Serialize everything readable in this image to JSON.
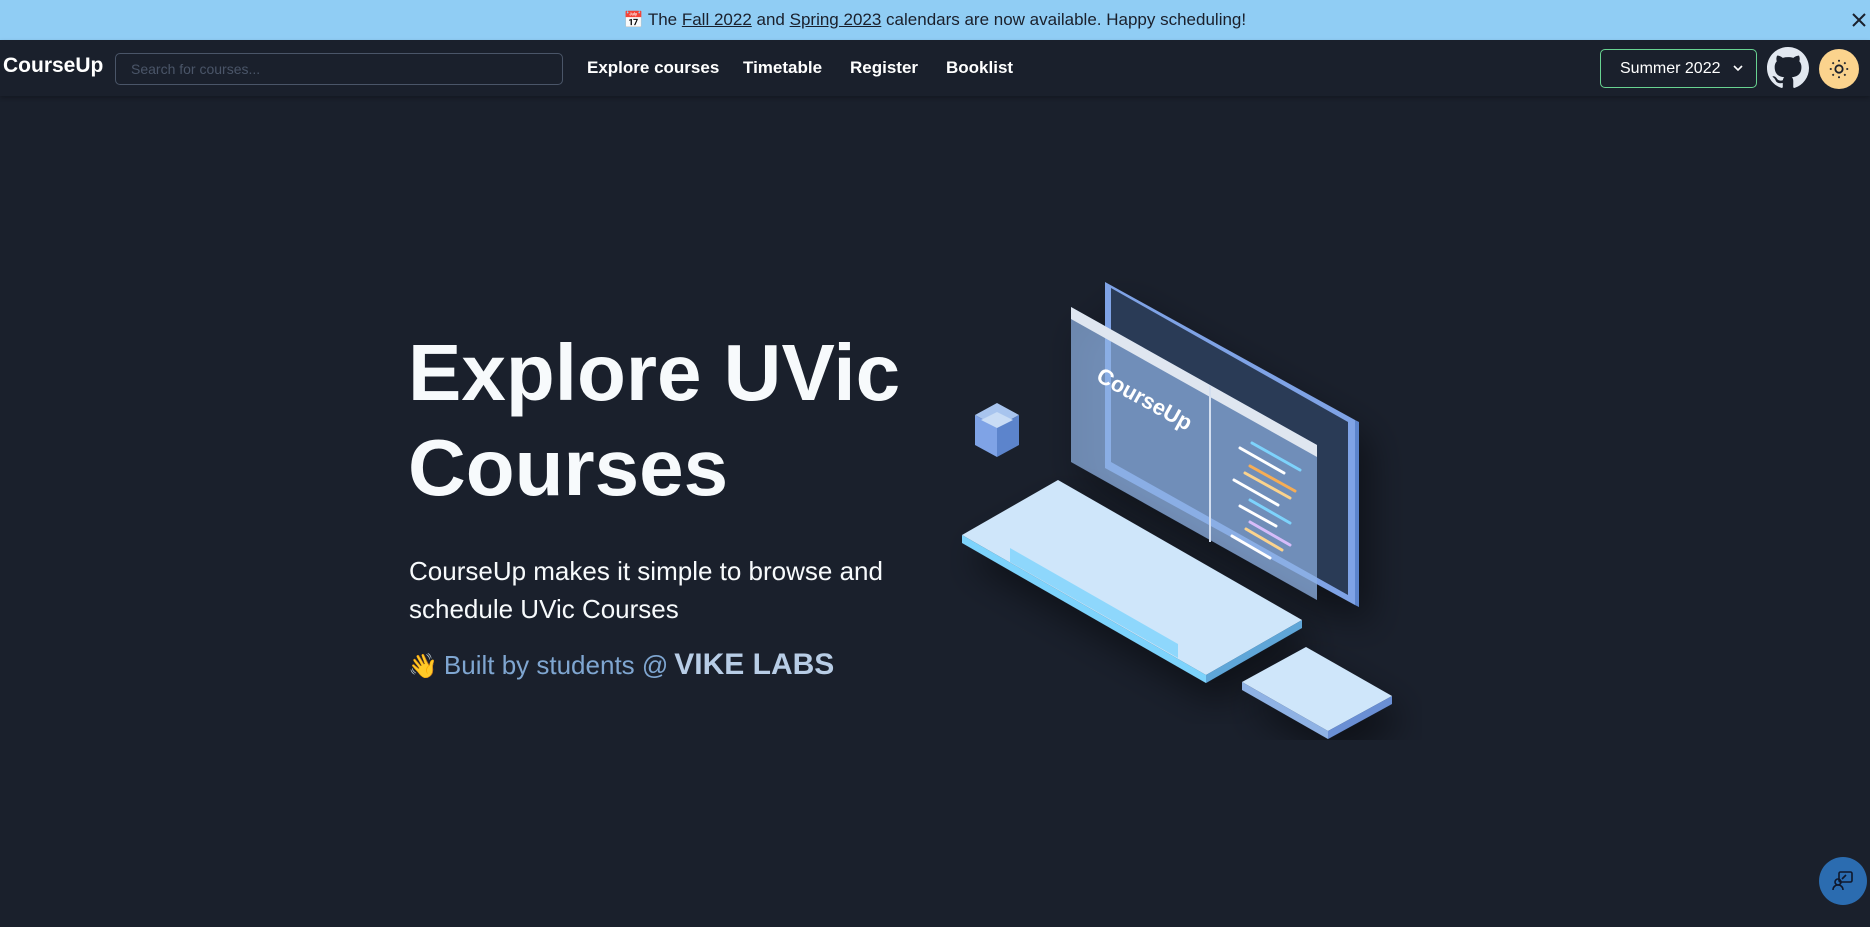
{
  "banner": {
    "icon": "calendar-icon",
    "prefix": "The",
    "link1": "Fall 2022",
    "and": "and",
    "link2": "Spring 2023",
    "suffix": "calendars are now available. Happy scheduling!",
    "background": "#90cdf4"
  },
  "nav": {
    "brand": "CourseUp",
    "search_placeholder": "Search for courses...",
    "links": [
      "Explore courses",
      "Timetable",
      "Register",
      "Booklist"
    ],
    "term": "Summer 2022",
    "term_border": "#68d391",
    "theme_button_color": "#fbd38d"
  },
  "hero": {
    "title_line1": "Explore UVic",
    "title_line2": "Courses",
    "subtitle": "CourseUp makes it simple to browse and schedule UVic Courses",
    "built_prefix": "Built by students @",
    "built_org": "VIKE LABS",
    "illustration_text": "CourseUp"
  },
  "colors": {
    "background": "#1a202c",
    "accent": "#90cdf4"
  }
}
